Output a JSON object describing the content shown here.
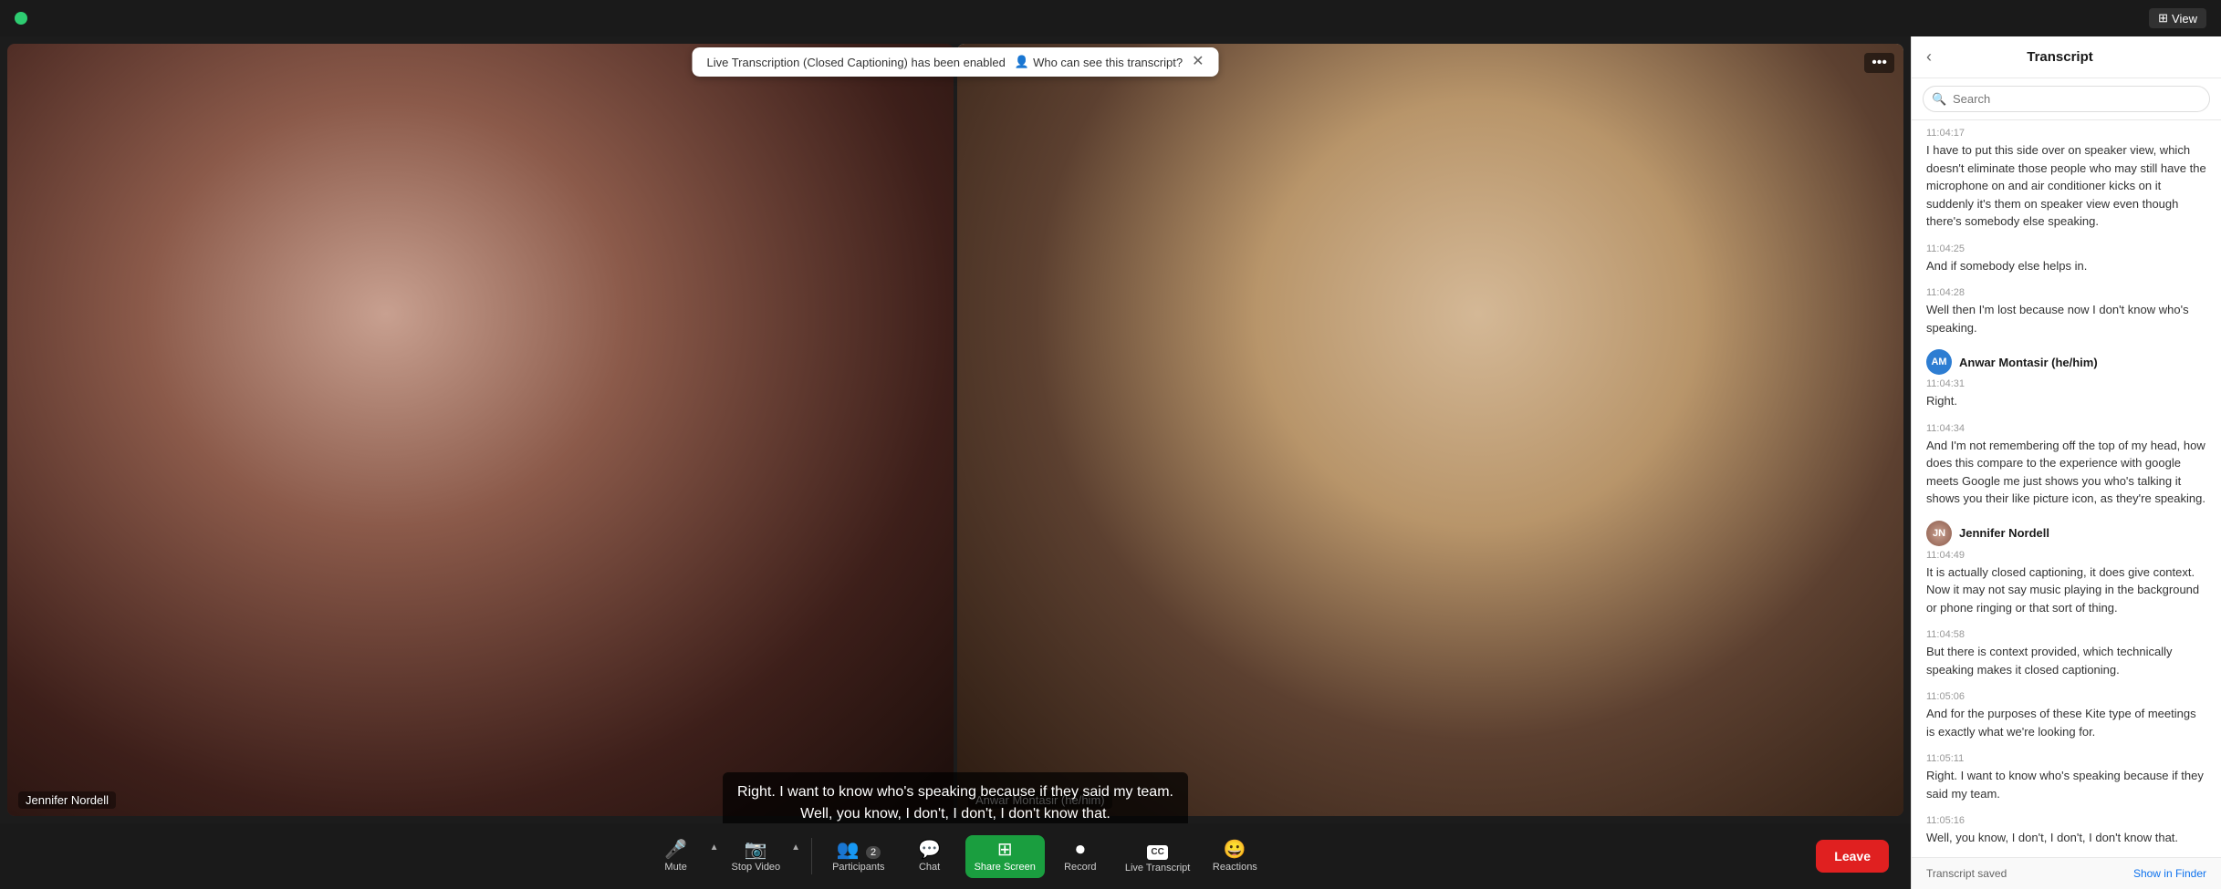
{
  "topbar": {
    "view_label": "View"
  },
  "notification": {
    "message": "Live Transcription (Closed Captioning) has been enabled",
    "who_can_see": "Who can see this transcript?"
  },
  "video": {
    "participant1_name": "Jennifer Nordell",
    "participant2_name": "Anwar Montasir (he/him)"
  },
  "subtitles": {
    "line1": "Right. I want to know who's speaking because if",
    "line2": "they said my team.",
    "line3": "Well, you know, I don't, I don't, I don't know that."
  },
  "toolbar": {
    "mute_label": "Mute",
    "stop_video_label": "Stop Video",
    "participants_label": "Participants",
    "participants_count": "2",
    "chat_label": "Chat",
    "share_screen_label": "Share Screen",
    "record_label": "Record",
    "live_transcript_label": "Live Transcript",
    "reactions_label": "Reactions",
    "leave_label": "Leave"
  },
  "transcript": {
    "title": "Transcript",
    "search_placeholder": "Search",
    "entries": [
      {
        "timestamp": "11:04:17",
        "text": "I have to put this side over on speaker view, which doesn't eliminate those people who may still have the microphone on and air conditioner kicks on it suddenly it's them on speaker view even though there's somebody else speaking.",
        "speaker": null
      },
      {
        "timestamp": "11:04:25",
        "text": "And if somebody else helps in.",
        "speaker": null
      },
      {
        "timestamp": "11:04:28",
        "text": "Well then I'm lost because now I don't know who's speaking.",
        "speaker": null
      },
      {
        "timestamp": "11:04:31",
        "speaker": "Anwar Montasir (he/him)",
        "speaker_initials": "AM",
        "speaker_type": "am",
        "text": "Right.",
        "show_speaker": true
      },
      {
        "timestamp": "11:04:34",
        "text": "And I'm not remembering off the top of my head, how does this compare to the experience with google meets Google me just shows you who's talking it shows you their like picture icon, as they're speaking.",
        "speaker": null
      },
      {
        "timestamp": "11:04:49",
        "speaker": "Jennifer Nordell",
        "speaker_type": "jn",
        "text": "It is actually closed captioning, it does give context. Now it may not say music playing in the background or phone ringing or that sort of thing.",
        "show_speaker": true
      },
      {
        "timestamp": "11:04:58",
        "text": "But there is context provided, which technically speaking makes it closed captioning.",
        "speaker": null
      },
      {
        "timestamp": "11:05:06",
        "text": "And for the purposes of these Kite type of meetings is exactly what we're looking for.",
        "speaker": null
      },
      {
        "timestamp": "11:05:11",
        "text": "Right. I want to know who's speaking because if they said my team.",
        "speaker": null
      },
      {
        "timestamp": "11:05:16",
        "text": "Well, you know, I don't, I don't, I don't know that.",
        "speaker": null
      }
    ],
    "footer_saved": "Transcript saved",
    "footer_finder": "Show in Finder"
  }
}
